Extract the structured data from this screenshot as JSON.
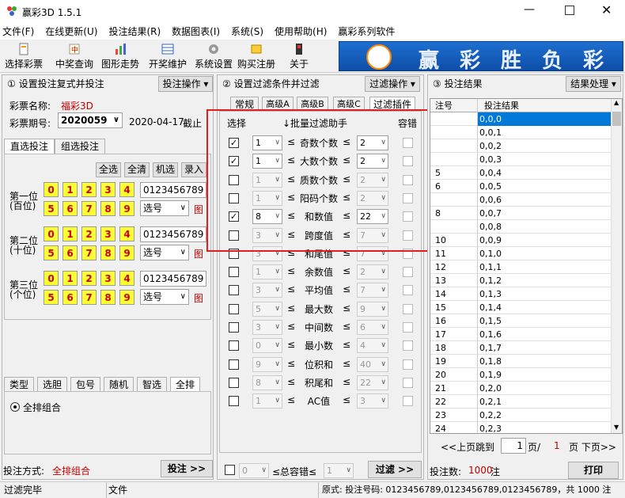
{
  "app": {
    "title": "赢彩3D 1.5.1"
  },
  "menu": [
    "文件(F)",
    "在线更新(U)",
    "投注结果(R)",
    "数据图表(I)",
    "系统(S)",
    "使用帮助(H)",
    "赢彩系列软件"
  ],
  "toolbar": [
    "选择彩票",
    "中奖查询",
    "图形走势",
    "开奖维护",
    "系统设置",
    "购买注册",
    "关于"
  ],
  "banner": {
    "chars": [
      "赢",
      "彩",
      "胜",
      "负",
      "彩"
    ]
  },
  "left": {
    "header": "① 设置投注复式并投注",
    "op_button": "投注操作 ▾",
    "lottery_name_label": "彩票名称:",
    "lottery_name": "福彩3D",
    "period_label": "彩票期号:",
    "period": "2020059",
    "date": "2020-04-17",
    "cutoff": "截止",
    "tabs": [
      "直选投注",
      "组选投注"
    ],
    "quick_buttons": [
      "全选",
      "全清",
      "机选",
      "录入"
    ],
    "positions": [
      {
        "label1": "第一位",
        "label2": "(百位)",
        "value": "0123456789",
        "select": "选号",
        "chart": "图"
      },
      {
        "label1": "第二位",
        "label2": "(十位)",
        "value": "0123456789",
        "select": "选号",
        "chart": "图"
      },
      {
        "label1": "第三位",
        "label2": "(个位)",
        "value": "0123456789",
        "select": "选号",
        "chart": "图"
      }
    ],
    "digits_row1": [
      "0",
      "1",
      "2",
      "3",
      "4"
    ],
    "digits_row2": [
      "5",
      "6",
      "7",
      "8",
      "9"
    ],
    "bottom_tabs": [
      "类型",
      "选胆",
      "包号",
      "随机",
      "智选",
      "全排"
    ],
    "radio_label": "全排组合",
    "mode_label": "投注方式:",
    "mode_value": "全排组合",
    "bet_button": "投注 >>"
  },
  "mid": {
    "header": "② 设置过滤条件并过滤",
    "op_button": "过滤操作 ▾",
    "tabs": [
      "常规",
      "高级A",
      "高级B",
      "高级C",
      "过滤插件"
    ],
    "col_select": "选择",
    "col_helper": "↓批量过滤助手",
    "col_tol": "容错",
    "rows": [
      {
        "checked": true,
        "min": "1",
        "name": "奇数个数",
        "max": "2",
        "enabled": true
      },
      {
        "checked": true,
        "min": "1",
        "name": "大数个数",
        "max": "2",
        "enabled": true
      },
      {
        "checked": false,
        "min": "1",
        "name": "质数个数",
        "max": "2",
        "enabled": false
      },
      {
        "checked": false,
        "min": "1",
        "name": "阳码个数",
        "max": "2",
        "enabled": false
      },
      {
        "checked": true,
        "min": "8",
        "name": "和数值",
        "max": "22",
        "enabled": true
      },
      {
        "checked": false,
        "min": "3",
        "name": "跨度值",
        "max": "7",
        "enabled": false
      },
      {
        "checked": false,
        "min": "3",
        "name": "和尾值",
        "max": "7",
        "enabled": false
      },
      {
        "checked": false,
        "min": "1",
        "name": "余数值",
        "max": "2",
        "enabled": false
      },
      {
        "checked": false,
        "min": "3",
        "name": "平均值",
        "max": "7",
        "enabled": false
      },
      {
        "checked": false,
        "min": "5",
        "name": "最大数",
        "max": "9",
        "enabled": false
      },
      {
        "checked": false,
        "min": "3",
        "name": "中间数",
        "max": "6",
        "enabled": false
      },
      {
        "checked": false,
        "min": "0",
        "name": "最小数",
        "max": "4",
        "enabled": false
      },
      {
        "checked": false,
        "min": "9",
        "name": "位积和",
        "max": "40",
        "enabled": false
      },
      {
        "checked": false,
        "min": "8",
        "name": "积尾和",
        "max": "22",
        "enabled": false
      },
      {
        "checked": false,
        "min": "1",
        "name": "AC值",
        "max": "3",
        "enabled": false
      }
    ],
    "footer_min": "0",
    "footer_label": "≤总容错≤",
    "footer_max": "1",
    "filter_button": "过滤 >>"
  },
  "right": {
    "header": "③ 投注结果",
    "op_button": "结果处理 ▾",
    "col_no": "注号",
    "col_result": "投注结果",
    "rows": [
      {
        "no": "",
        "v": "0,0,0"
      },
      {
        "no": "",
        "v": "0,0,1"
      },
      {
        "no": "",
        "v": "0,0,2"
      },
      {
        "no": "",
        "v": "0,0,3"
      },
      {
        "no": "5",
        "v": "0,0,4"
      },
      {
        "no": "6",
        "v": "0,0,5"
      },
      {
        "no": "",
        "v": "0,0,6"
      },
      {
        "no": "8",
        "v": "0,0,7"
      },
      {
        "no": "",
        "v": "0,0,8"
      },
      {
        "no": "10",
        "v": "0,0,9"
      },
      {
        "no": "11",
        "v": "0,1,0"
      },
      {
        "no": "12",
        "v": "0,1,1"
      },
      {
        "no": "13",
        "v": "0,1,2"
      },
      {
        "no": "14",
        "v": "0,1,3"
      },
      {
        "no": "15",
        "v": "0,1,4"
      },
      {
        "no": "16",
        "v": "0,1,5"
      },
      {
        "no": "17",
        "v": "0,1,6"
      },
      {
        "no": "18",
        "v": "0,1,7"
      },
      {
        "no": "19",
        "v": "0,1,8"
      },
      {
        "no": "20",
        "v": "0,1,9"
      },
      {
        "no": "21",
        "v": "0,2,0"
      },
      {
        "no": "22",
        "v": "0,2,1"
      },
      {
        "no": "23",
        "v": "0,2,2"
      },
      {
        "no": "24",
        "v": "0,2,3"
      }
    ],
    "prev": "<<上页",
    "goto": "跳到",
    "page": "1",
    "page_sep": "页/",
    "total_pages": "1",
    "next": "页 下页>>",
    "count_label": "投注数:",
    "count": "1000",
    "count_unit": "注",
    "print_button": "打印"
  },
  "status": {
    "left": "过滤完毕",
    "mid": "文件",
    "right": "原式: 投注号码: 0123456789,0123456789,0123456789，共 1000 注"
  }
}
